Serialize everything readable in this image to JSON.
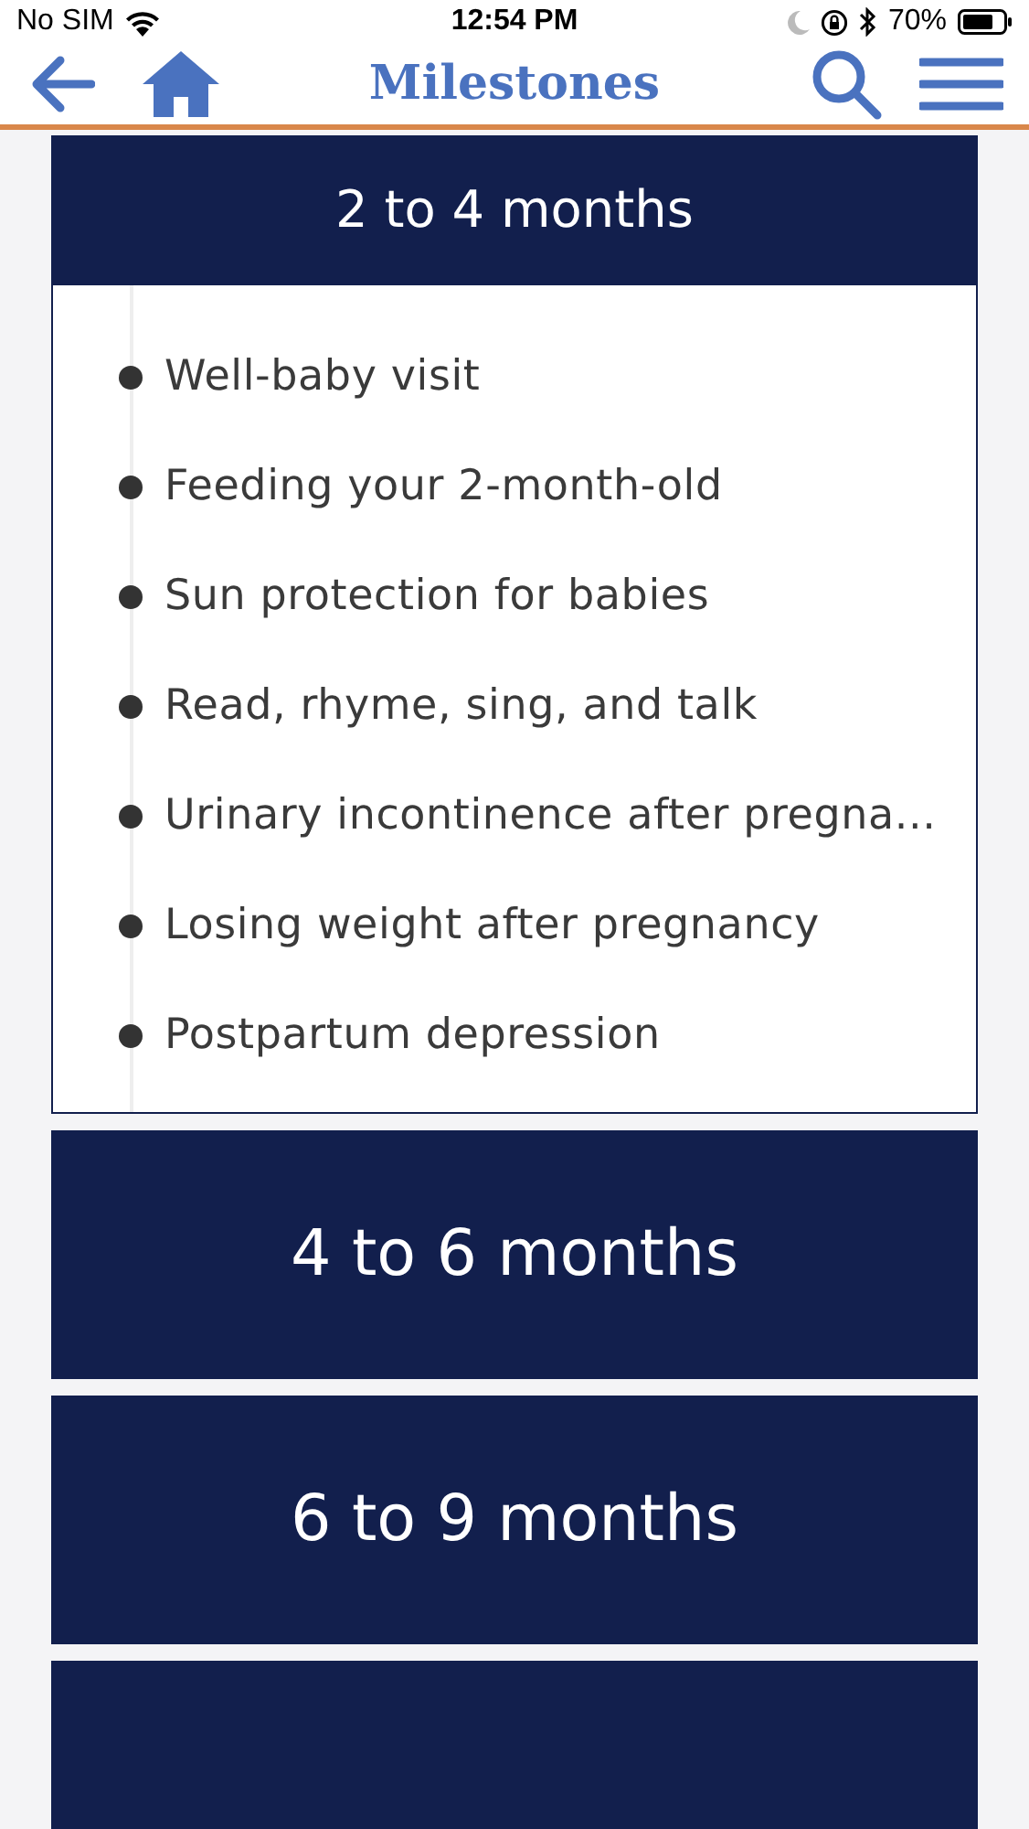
{
  "status_bar": {
    "carrier": "No SIM",
    "time": "12:54 PM",
    "battery": "70%"
  },
  "nav_bar": {
    "title": "Milestones"
  },
  "sections": [
    {
      "title": "2 to 4 months",
      "expanded": true,
      "items": [
        "Well-baby visit",
        "Feeding your 2-month-old",
        "Sun protection for babies",
        "Read, rhyme, sing, and talk",
        "Urinary incontinence after pregna...",
        "Losing weight after pregnancy",
        "Postpartum depression"
      ]
    },
    {
      "title": "4 to 6 months",
      "expanded": false
    },
    {
      "title": "6 to 9 months",
      "expanded": false
    },
    {
      "expanded": false
    }
  ]
}
